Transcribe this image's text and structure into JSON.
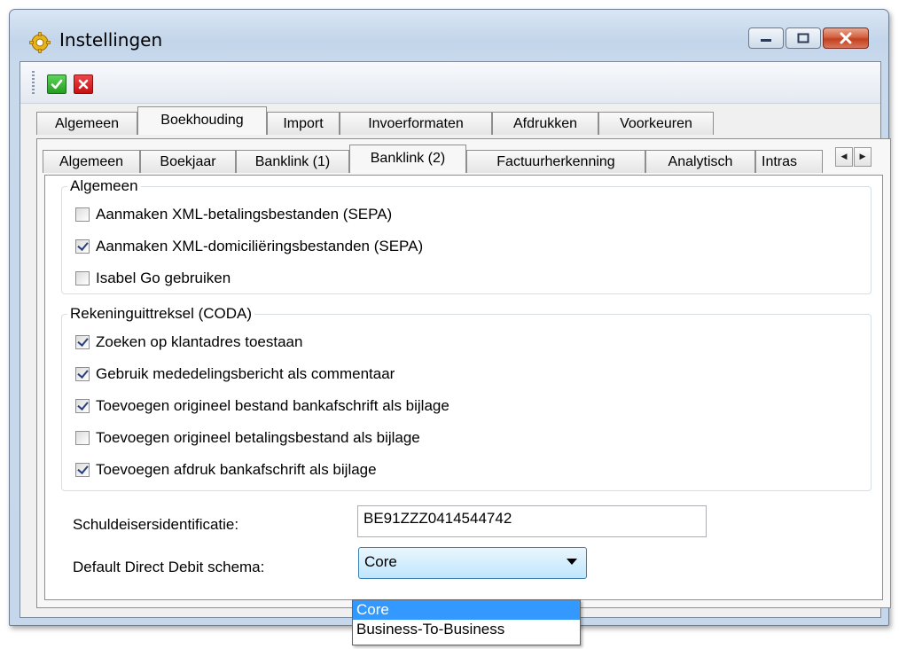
{
  "window": {
    "title": "Instellingen",
    "app_icon": "gear-icon",
    "controls": [
      "minimize-icon",
      "maximize-icon",
      "close-icon"
    ]
  },
  "toolbar": {
    "ok_icon": "checkmark-icon",
    "cancel_icon": "x-icon",
    "ok_color": "#249d20",
    "cancel_color": "#c60f13"
  },
  "main_tabs": [
    "Algemeen",
    "Boekhouding",
    "Import",
    "Invoerformaten",
    "Afdrukken",
    "Voorkeuren"
  ],
  "main_tab_active": "Boekhouding",
  "sub_tabs": [
    "Algemeen",
    "Boekjaar",
    "Banklink (1)",
    "Banklink (2)",
    "Factuurherkenning",
    "Analytisch",
    "Intras"
  ],
  "sub_tab_active": "Banklink (2)",
  "group_algemeen": {
    "legend": "Algemeen",
    "items": [
      {
        "label": "Aanmaken XML-betalingsbestanden (SEPA)",
        "checked": false
      },
      {
        "label": "Aanmaken XML-domiciliëringsbestanden (SEPA)",
        "checked": true
      },
      {
        "label": "Isabel Go gebruiken",
        "checked": false
      }
    ]
  },
  "group_coda": {
    "legend": "Rekeninguittreksel (CODA)",
    "items": [
      {
        "label": "Zoeken op klantadres toestaan",
        "checked": true
      },
      {
        "label": "Gebruik mededelingsbericht als commentaar",
        "checked": true
      },
      {
        "label": "Toevoegen origineel bestand bankafschrift als bijlage",
        "checked": true
      },
      {
        "label": "Toevoegen origineel betalingsbestand als bijlage",
        "checked": false
      },
      {
        "label": "Toevoegen afdruk bankafschrift als bijlage",
        "checked": true
      }
    ]
  },
  "creditor_id": {
    "label": "Schuldeisersidentificatie:",
    "value": "BE91ZZZ0414544742"
  },
  "direct_debit": {
    "label": "Default Direct Debit schema:",
    "value": "Core",
    "options": [
      "Core",
      "Business-To-Business"
    ],
    "selected_index": 0
  }
}
